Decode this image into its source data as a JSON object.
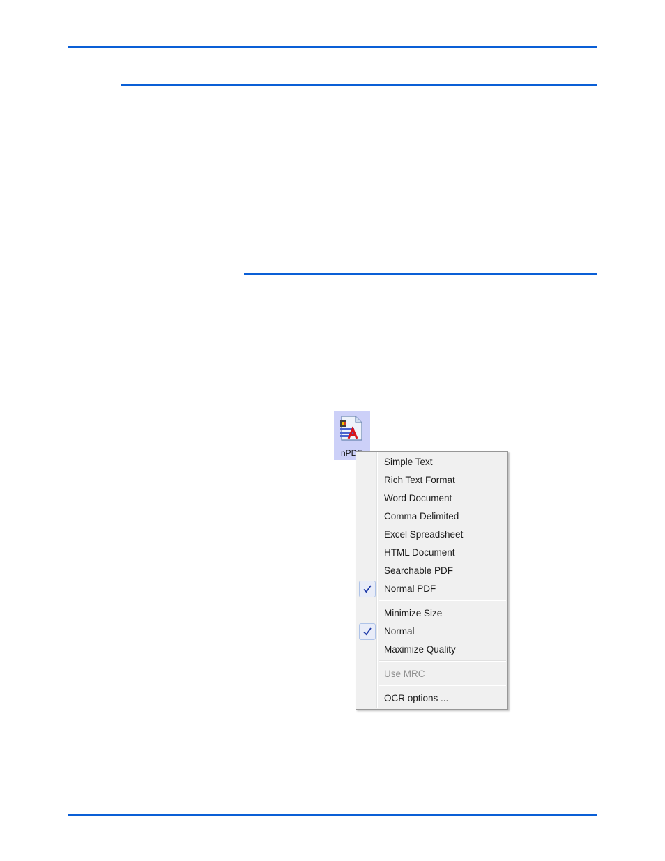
{
  "page": {
    "accent_color": "#0a5fd6"
  },
  "desktop_icon": {
    "label": "nPDF",
    "icon": "npdf-document-icon"
  },
  "context_menu": {
    "groups": [
      {
        "items": [
          {
            "label": "Simple Text",
            "checked": false,
            "enabled": true
          },
          {
            "label": "Rich Text Format",
            "checked": false,
            "enabled": true
          },
          {
            "label": "Word Document",
            "checked": false,
            "enabled": true
          },
          {
            "label": "Comma Delimited",
            "checked": false,
            "enabled": true
          },
          {
            "label": "Excel Spreadsheet",
            "checked": false,
            "enabled": true
          },
          {
            "label": "HTML Document",
            "checked": false,
            "enabled": true
          },
          {
            "label": "Searchable PDF",
            "checked": false,
            "enabled": true
          },
          {
            "label": "Normal PDF",
            "checked": true,
            "enabled": true
          }
        ]
      },
      {
        "items": [
          {
            "label": "Minimize Size",
            "checked": false,
            "enabled": true
          },
          {
            "label": "Normal",
            "checked": true,
            "enabled": true
          },
          {
            "label": "Maximize Quality",
            "checked": false,
            "enabled": true
          }
        ]
      },
      {
        "items": [
          {
            "label": "Use MRC",
            "checked": false,
            "enabled": false
          }
        ]
      },
      {
        "items": [
          {
            "label": "OCR options ...",
            "checked": false,
            "enabled": true
          }
        ]
      }
    ]
  }
}
